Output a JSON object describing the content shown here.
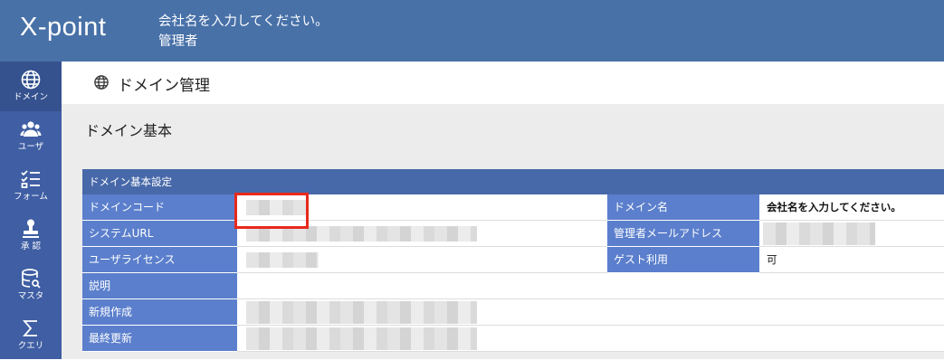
{
  "header": {
    "logo_text": "X-point",
    "company_name": "会社名を入力してください。",
    "role": "管理者"
  },
  "sidenav": {
    "items": [
      {
        "label": "ドメイン",
        "icon": "globe-icon",
        "active": true
      },
      {
        "label": "ユーザ",
        "icon": "users-icon",
        "active": false
      },
      {
        "label": "フォーム",
        "icon": "form-checklist-icon",
        "active": false
      },
      {
        "label": "承 認",
        "icon": "stamp-icon",
        "active": false
      },
      {
        "label": "マスタ",
        "icon": "database-icon",
        "active": false
      },
      {
        "label": "クエリ",
        "icon": "sigma-icon",
        "active": false
      }
    ]
  },
  "page": {
    "title": "ドメイン管理",
    "section_heading": "ドメイン基本"
  },
  "panel": {
    "header": "ドメイン基本設定",
    "rows": [
      {
        "label": "ドメインコード",
        "value": "",
        "right_label": "ドメイン名",
        "right_value": "会社名を入力してください。"
      },
      {
        "label": "システムURL",
        "value": "",
        "right_label": "管理者メールアドレス",
        "right_value": ""
      },
      {
        "label": "ユーザライセンス",
        "value": "",
        "right_label": "ゲスト利用",
        "right_value": "可"
      },
      {
        "label": "説明",
        "value": ""
      },
      {
        "label": "新規作成",
        "value": ""
      },
      {
        "label": "最終更新",
        "value": ""
      }
    ]
  },
  "colors": {
    "header_bg": "#4871a8",
    "sidenav_bg": "#3f5ea3",
    "label_bg": "#5b7fcc",
    "panel_header_bg": "#4869a9",
    "highlight": "#e8291c"
  }
}
